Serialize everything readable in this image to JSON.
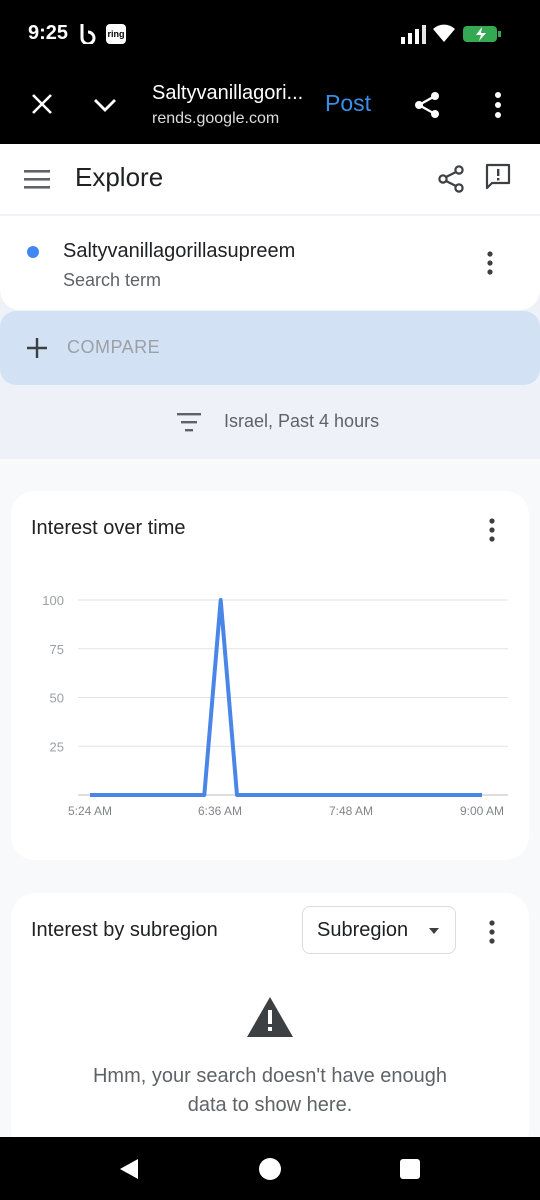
{
  "status_bar": {
    "time": "9:25",
    "ring_label": "ring"
  },
  "browser": {
    "page_title": "Saltyvanillagori...",
    "url": "rends.google.com",
    "post_label": "Post"
  },
  "app_bar": {
    "title": "Explore"
  },
  "search_term": {
    "name": "Saltyvanillagorillasupreem",
    "type": "Search term",
    "color": "#4285f4"
  },
  "compare": {
    "label": "COMPARE"
  },
  "filters": {
    "label": "Israel, Past 4 hours"
  },
  "interest_over_time": {
    "title": "Interest over time"
  },
  "chart_data": {
    "type": "line",
    "title": "Interest over time",
    "x_tick_labels": [
      "5:24 AM",
      "6:36 AM",
      "7:48 AM",
      "9:00 AM"
    ],
    "y_tick_labels": [
      "100",
      "75",
      "50",
      "25"
    ],
    "ylim": [
      0,
      100
    ],
    "grid": true,
    "line_color": "#4a86e8",
    "series": [
      {
        "x": [
          "5:24 AM",
          "6:27 AM",
          "6:36 AM",
          "6:45 AM",
          "9:00 AM"
        ],
        "values": [
          0,
          0,
          100,
          0,
          0
        ]
      }
    ]
  },
  "subregion": {
    "title": "Interest by subregion",
    "select_value": "Subregion",
    "message_line1": "Hmm, your search doesn't have enough",
    "message_line2": "data to show here."
  },
  "icons": {
    "close": "close-icon",
    "chevron": "chevron-down-icon",
    "share": "share-icon",
    "more": "more-vert-icon",
    "menu": "menu-icon",
    "feedback": "feedback-icon",
    "plus": "plus-icon",
    "filter": "filter-icon",
    "warning": "warning-icon"
  }
}
